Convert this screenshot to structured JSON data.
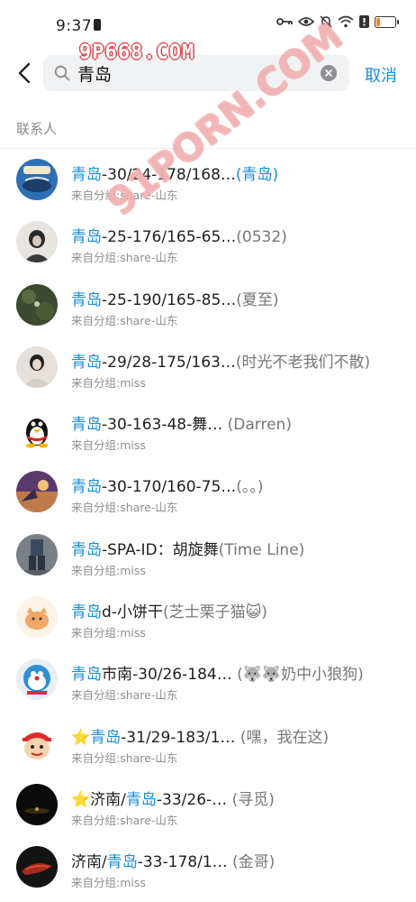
{
  "status_bar": {
    "time": "9:37"
  },
  "watermark": {
    "top": "9P668.COM",
    "diagonal": "91PORN.COM"
  },
  "search": {
    "back_label": "‹",
    "query": "青岛",
    "cancel_label": "取消"
  },
  "section": {
    "title": "联系人"
  },
  "contacts": [
    {
      "pre": "",
      "hl": "青岛",
      "post": "-30/24-178/168…",
      "nick": "(青岛)",
      "nick_hl": true,
      "group": "来自分组:share-山东"
    },
    {
      "pre": "",
      "hl": "青岛",
      "post": "-25-176/165-65…",
      "nick": "(0532)",
      "nick_hl": false,
      "group": "来自分组:share-山东"
    },
    {
      "pre": "",
      "hl": "青岛",
      "post": "-25-190/165-85…",
      "nick": "(夏至)",
      "nick_hl": false,
      "group": "来自分组:share-山东"
    },
    {
      "pre": "",
      "hl": "青岛",
      "post": "-29/28-175/163…",
      "nick": "(时光不老我们不散)",
      "nick_hl": false,
      "group": "来自分组:miss"
    },
    {
      "pre": "",
      "hl": "青岛",
      "post": "-30-163-48-舞…",
      "nick": " (Darren)",
      "nick_hl": false,
      "group": "来自分组:miss"
    },
    {
      "pre": "",
      "hl": "青岛",
      "post": "-30-170/160-75…",
      "nick": "(。。)",
      "nick_hl": false,
      "group": "来自分组:share-山东"
    },
    {
      "pre": "",
      "hl": "青岛",
      "post": "-SPA-ID：胡旋舞",
      "nick": "(Time Line)",
      "nick_hl": false,
      "group": "来自分组:miss"
    },
    {
      "pre": "",
      "hl": "青岛",
      "post": "d-小饼干",
      "nick": "(芝士栗子猫😺)",
      "nick_hl": false,
      "group": "来自分组:miss"
    },
    {
      "pre": "",
      "hl": "青岛",
      "post": "市南-30/26-184…",
      "nick": " (🐺🐺奶中小狼狗)",
      "nick_hl": false,
      "group": "来自分组:share-山东"
    },
    {
      "pre": "⭐",
      "hl": "青岛",
      "post": "-31/29-183/1…",
      "nick": " (嘿，我在这)",
      "nick_hl": false,
      "group": "来自分组:share-山东"
    },
    {
      "pre": "⭐济南/",
      "hl": "青岛",
      "post": "-33/26-…",
      "nick": " (寻觅)",
      "nick_hl": false,
      "group": "来自分组:share-山东"
    },
    {
      "pre": "济南/",
      "hl": "青岛",
      "post": "-33-178/1…",
      "nick": " (金哥)",
      "nick_hl": false,
      "group": "来自分组:miss"
    }
  ],
  "colors": {
    "highlight": "#1a8cdb",
    "secondary_text": "#8f8f8f"
  }
}
